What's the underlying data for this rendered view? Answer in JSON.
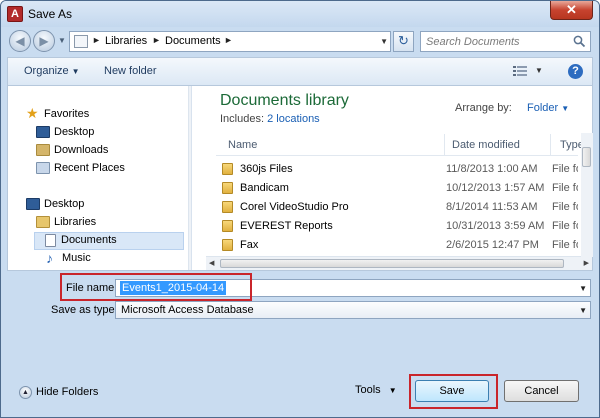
{
  "window": {
    "title": "Save As",
    "app_icon_letter": "A",
    "close_symbol": "✕"
  },
  "address": {
    "segments": [
      "Libraries",
      "Documents"
    ],
    "search_placeholder": "Search Documents"
  },
  "toolbar": {
    "organize_label": "Organize",
    "new_folder_label": "New folder",
    "help_label": "?"
  },
  "nav": {
    "favorites_label": "Favorites",
    "favorites": [
      "Desktop",
      "Downloads",
      "Recent Places"
    ],
    "desktop_label": "Desktop",
    "libraries_label": "Libraries",
    "libraries": [
      "Documents",
      "Music"
    ],
    "selected": "Documents"
  },
  "content": {
    "library_title": "Documents library",
    "includes_prefix": "Includes:",
    "includes_link": "2 locations",
    "arrange_label": "Arrange by:",
    "arrange_value": "Folder",
    "columns": [
      "Name",
      "Date modified",
      "Type"
    ],
    "rows": [
      {
        "name": "360js Files",
        "date": "11/8/2013 1:00 AM",
        "type": "File folder"
      },
      {
        "name": "Bandicam",
        "date": "10/12/2013 1:57 AM",
        "type": "File folder"
      },
      {
        "name": "Corel VideoStudio Pro",
        "date": "8/1/2014 11:53 AM",
        "type": "File folder"
      },
      {
        "name": "EVEREST Reports",
        "date": "10/31/2013 3:59 AM",
        "type": "File folder"
      },
      {
        "name": "Fax",
        "date": "2/6/2015 12:47 PM",
        "type": "File folder"
      }
    ]
  },
  "form": {
    "filename_label": "File name:",
    "filename_value": "Events1_2015-04-14",
    "savetype_label": "Save as type:",
    "savetype_value": "Microsoft Access Database"
  },
  "footer": {
    "hide_folders_label": "Hide Folders",
    "tools_label": "Tools",
    "save_label": "Save",
    "cancel_label": "Cancel"
  },
  "colors": {
    "highlight_box": "#c9252b",
    "library_title": "#1c6a38",
    "link": "#1a5fb4",
    "selection": "#3399ff"
  }
}
